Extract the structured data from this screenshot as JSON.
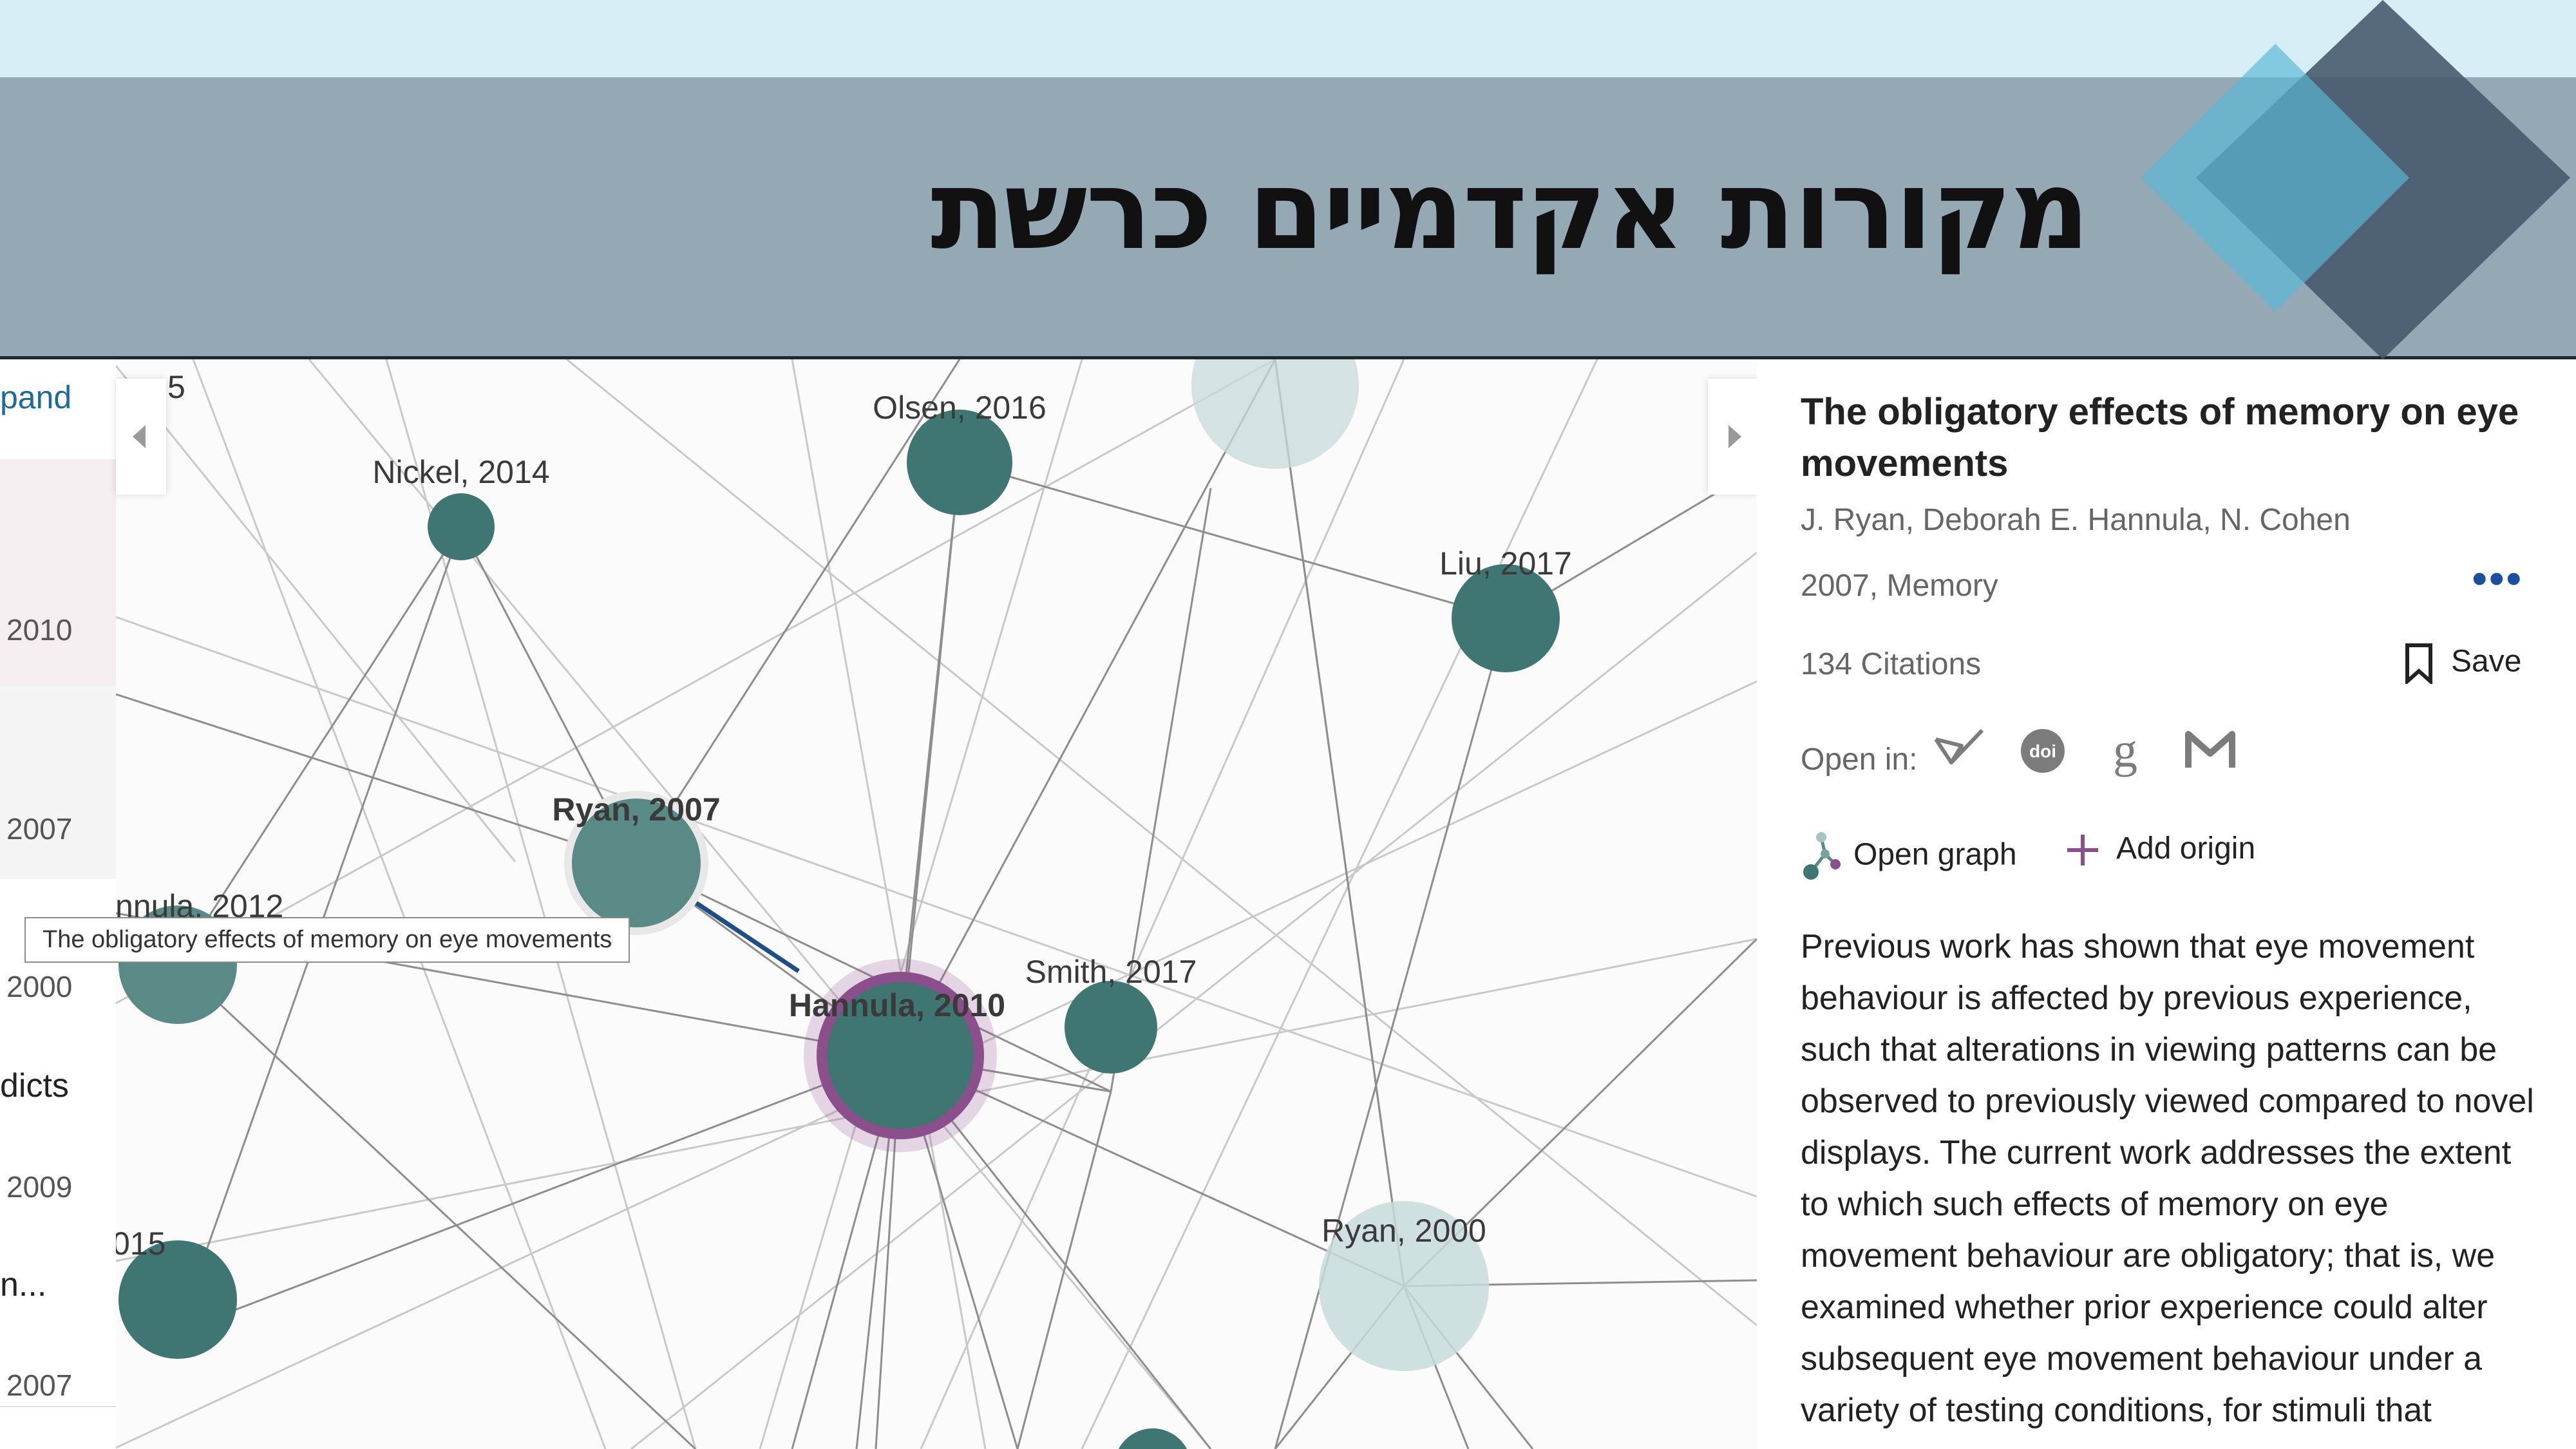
{
  "slide": {
    "title": "מקורות אקדמיים כרשת"
  },
  "left_list": {
    "expand_link": "pand",
    "items": [
      {
        "year": "2010"
      },
      {
        "year": "2007"
      },
      {
        "year": "2000"
      },
      {
        "text": "dicts"
      },
      {
        "year": "2009"
      },
      {
        "text": "n..."
      },
      {
        "year": "2007"
      }
    ]
  },
  "graph": {
    "nodes": [
      {
        "label": "Nickel, 2014"
      },
      {
        "label": "Olsen, 2016"
      },
      {
        "label": "Liu, 2017"
      },
      {
        "label": "Ryan, 2007"
      },
      {
        "label": "nnula, 2012"
      },
      {
        "label": "Hannula, 2010"
      },
      {
        "label": "Smith, 2017"
      },
      {
        "label": "Ryan, 2000"
      },
      {
        "label": "015"
      },
      {
        "label": "5"
      }
    ],
    "tooltip": "The obligatory effects of memory on eye movements",
    "colors": {
      "node_dark": "#3f7672",
      "node_light": "#c7dbda",
      "selected_ring": "#8b4f8c",
      "selected_edge": "#1d4f86"
    }
  },
  "panel": {
    "title": "The obligatory effects of memory on eye movements",
    "authors": "J. Ryan, Deborah E. Hannula, N. Cohen",
    "meta": "2007, Memory",
    "more": "•••",
    "citations": "134 Citations",
    "save": "Save",
    "open_in_label": "Open in:",
    "open_in_icons": [
      "semantic-scholar-icon",
      "doi-icon",
      "google-scholar-icon",
      "microsoft-academic-icon"
    ],
    "open_graph": "Open graph",
    "add_origin": "Add origin",
    "abstract": "Previous work has shown that eye movement behaviour is affected by previous experience, such that alterations in viewing patterns can be observed to previously viewed compared to novel displays. The current work addresses the extent to which such effects of memory on eye movement behaviour are obligatory; that is, we examined whether prior experience could alter subsequent eye movement behaviour under a variety of testing conditions, for stimuli that"
  }
}
